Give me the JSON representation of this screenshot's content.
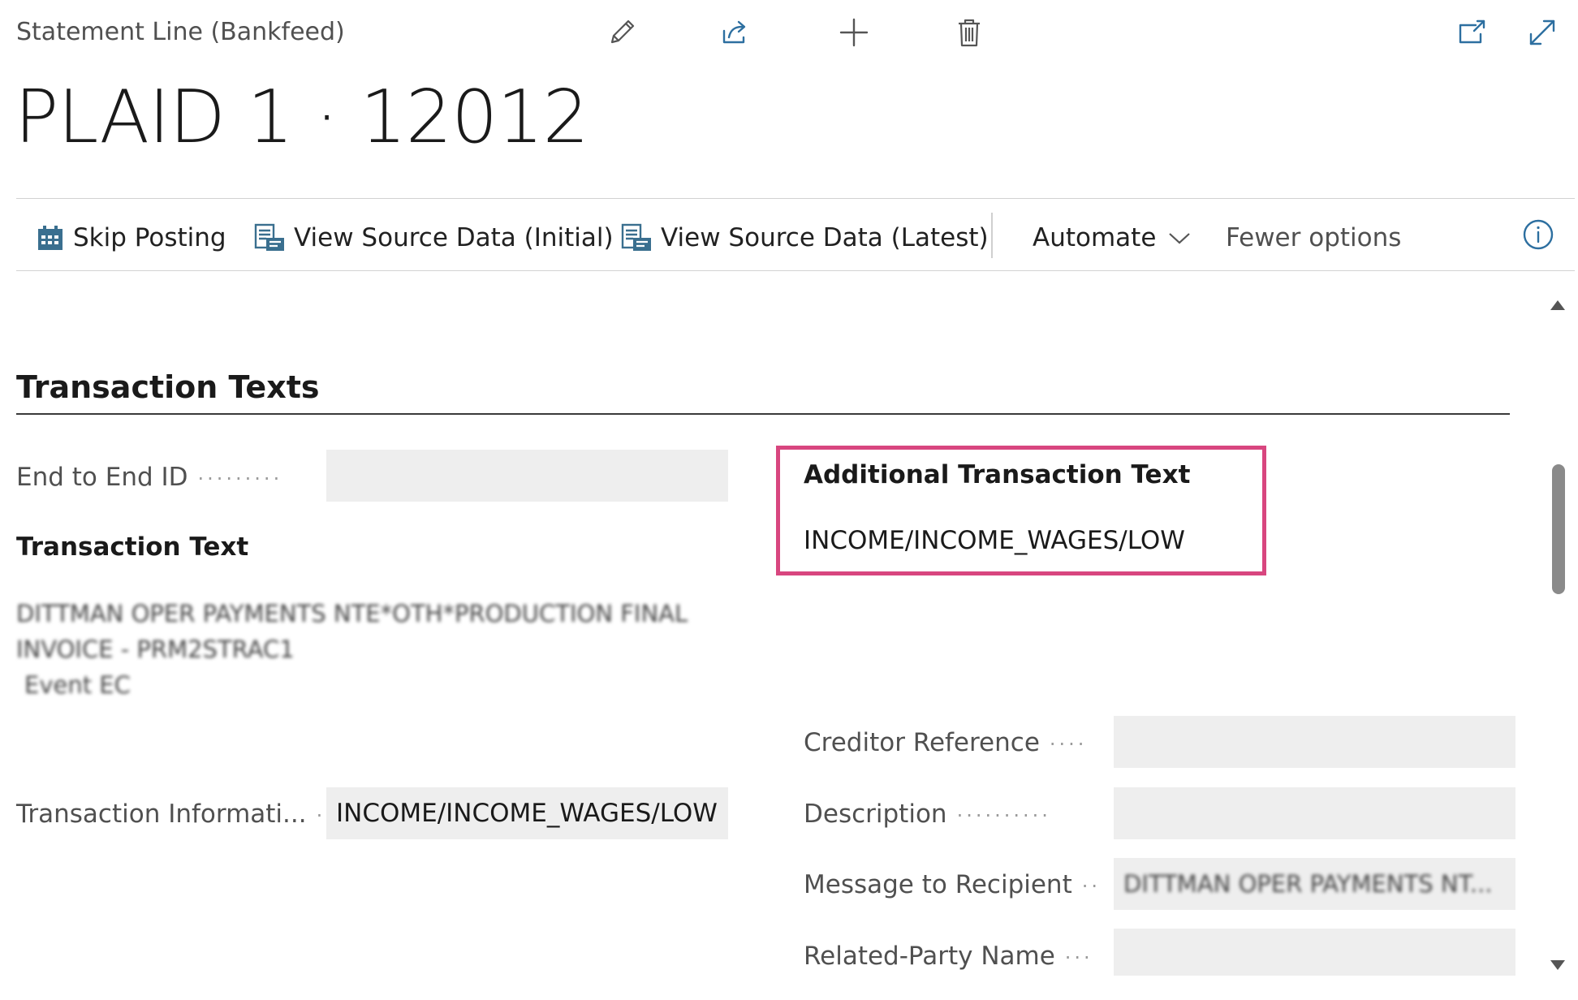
{
  "header": {
    "caption": "Statement Line (Bankfeed)",
    "title": "PLAID 1 · 12012",
    "icons": [
      "edit-pencil-icon",
      "share-icon",
      "add-icon",
      "delete-icon",
      "open-new-window-icon",
      "expand-icon"
    ]
  },
  "actions": {
    "skip_posting": "Skip Posting",
    "view_source_initial": "View Source Data (Initial)",
    "view_source_latest": "View Source Data (Latest)",
    "automate": "Automate",
    "fewer_options": "Fewer options"
  },
  "section": {
    "title": "Transaction Texts"
  },
  "fields": {
    "end_to_end_id": {
      "label": "End to End ID",
      "value": ""
    },
    "transaction_text": {
      "label": "Transaction Text",
      "lines": [
        "DITTMAN OPER PAYMENTS NTE*OTH*PRODUCTION FINAL",
        "INVOICE - PRM2STRAC1",
        "Event EC"
      ]
    },
    "transaction_information": {
      "label": "Transaction Informati...",
      "value": "INCOME/INCOME_WAGES/LOW"
    },
    "additional_transaction_text": {
      "label": "Additional Transaction Text",
      "value": "INCOME/INCOME_WAGES/LOW"
    },
    "creditor_reference": {
      "label": "Creditor Reference",
      "value": ""
    },
    "description": {
      "label": "Description",
      "value": ""
    },
    "message_to_recipient": {
      "label": "Message to Recipient",
      "value": "DITTMAN OPER PAYMENTS NT..."
    },
    "related_party_name": {
      "label": "Related-Party Name",
      "value": ""
    }
  },
  "colors": {
    "highlight": "#d8467f",
    "accent": "#3a6f8f",
    "field_background": "#eeeeee"
  }
}
